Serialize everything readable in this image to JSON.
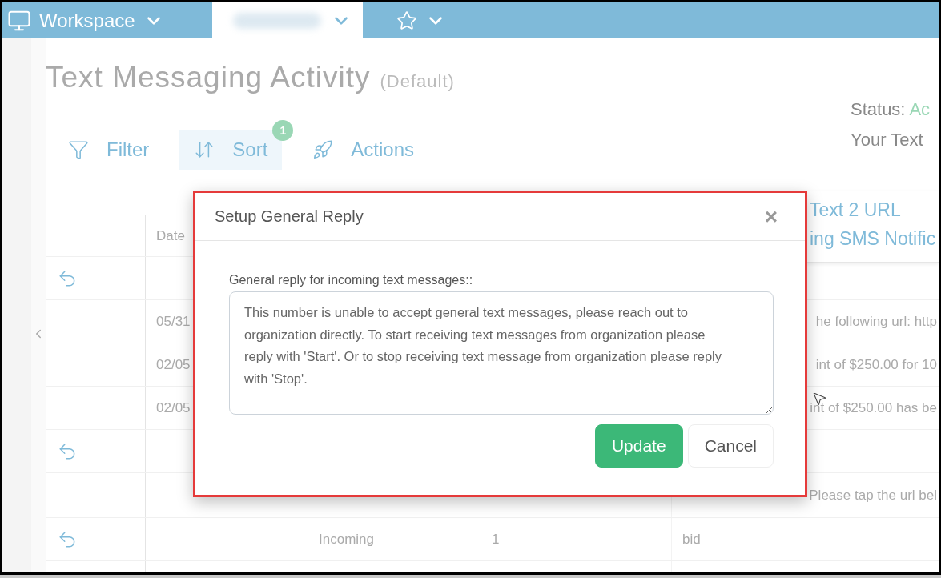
{
  "nav": {
    "tabs": [
      {
        "kind": "workspace",
        "label": "Workspace",
        "selected": false
      },
      {
        "kind": "reports",
        "selected": true
      },
      {
        "kind": "favorites",
        "selected": false
      }
    ]
  },
  "page": {
    "title": "Text Messaging Activity",
    "subtitle": "(Default)"
  },
  "toolbar": [
    {
      "kind": "filter",
      "label": "Filter",
      "selected": false
    },
    {
      "kind": "sort",
      "label": "Sort",
      "selected": true,
      "badge": "1"
    },
    {
      "kind": "actions",
      "label": "Actions",
      "selected": false
    }
  ],
  "status": {
    "label": "Status:",
    "value": "Ac"
  },
  "your_text": "Your Text",
  "actions_menu": [
    "Text 2 URL",
    "ing SMS Notific"
  ],
  "table": {
    "header": "Date",
    "rows": [
      {
        "kind": "full",
        "reply": true
      },
      {
        "kind": "covered",
        "reply": false,
        "date": "05/31",
        "message": "he following url: http"
      },
      {
        "kind": "covered",
        "reply": false,
        "date": "02/05",
        "message": "int of $250.00 for 10"
      },
      {
        "kind": "covered",
        "reply": false,
        "date": "02/05",
        "message": "int of $250.00 has be"
      },
      {
        "kind": "full",
        "reply": true
      },
      {
        "kind": "covered",
        "reply": false,
        "message": "Please tap the url bel"
      },
      {
        "kind": "full",
        "reply": true,
        "type": "Incoming",
        "count": "1",
        "message": "bid"
      },
      {
        "kind": "full",
        "reply": false
      }
    ]
  },
  "modal": {
    "title": "Setup General Reply",
    "close": "×",
    "label": "General reply for incoming text messages::",
    "value": "This number is unable to accept general text messages, please reach out to organization directly. To start receiving text messages from organization please reply with 'Start'. Or to stop receiving text message from organization please reply with 'Stop'.",
    "buttons": [
      {
        "kind": "primary",
        "label": "Update"
      },
      {
        "kind": "secondary",
        "label": "Cancel"
      }
    ]
  }
}
